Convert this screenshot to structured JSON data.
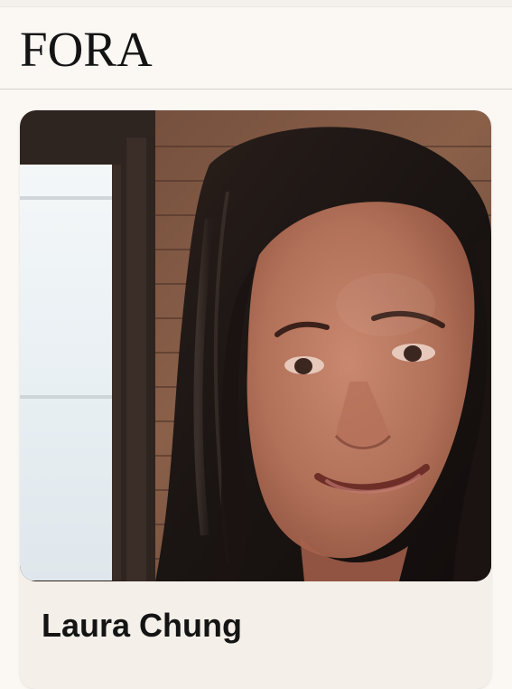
{
  "header": {
    "logo_text": "FORA"
  },
  "advisor_card": {
    "name": "Laura Chung",
    "photo_icon": "advisor-profile-photo"
  }
}
